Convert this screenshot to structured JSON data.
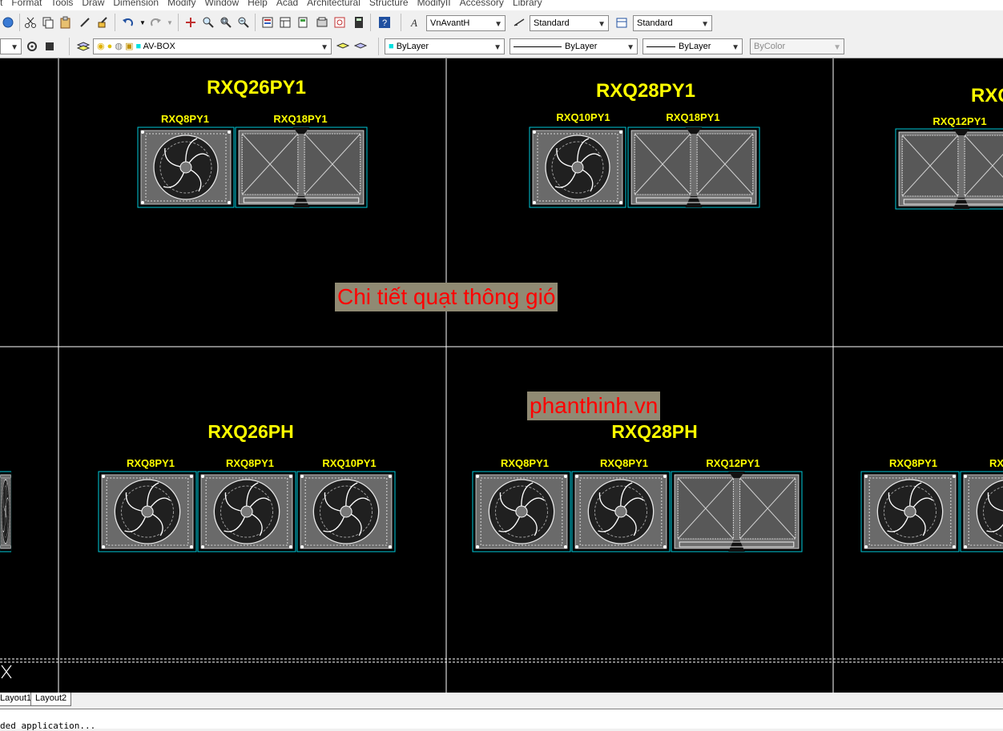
{
  "menu": [
    "t",
    "Format",
    "Tools",
    "Draw",
    "Dimension",
    "Modify",
    "Window",
    "Help",
    "Acad",
    "Architectural",
    "Structure",
    "ModifyII",
    "Accessory",
    "Library"
  ],
  "toolbar1": {
    "text_style": "VnAvantH",
    "dim_style": "Standard",
    "table_style": "Standard"
  },
  "toolbar2": {
    "layer": "AV-BOX",
    "color": "ByLayer",
    "linetype": "ByLayer",
    "lineweight": "ByLayer",
    "plot_style": "ByColor"
  },
  "drawing": {
    "titles": [
      "RXQ26PY1",
      "RXQ28PY1",
      "RXQ",
      "RXQ26PH",
      "RXQ28PH"
    ],
    "module_labels": {
      "g1": [
        "RXQ8PY1",
        "RXQ18PY1"
      ],
      "g2": [
        "RXQ10PY1",
        "RXQ18PY1"
      ],
      "g3": [
        "RXQ12PY1"
      ],
      "g4": [
        "RXQ8PY1",
        "RXQ8PY1",
        "RXQ10PY1"
      ],
      "g5": [
        "RXQ8PY1",
        "RXQ8PY1",
        "RXQ12PY1"
      ],
      "g6": [
        "RXQ8PY1",
        "RX"
      ]
    }
  },
  "overlays": {
    "caption": "Chi tiết quạt thông gió",
    "watermark": "phanthinh.vn"
  },
  "colors": {
    "title": "#ffff00",
    "grid": "#ffffff",
    "frame": "#00ffff",
    "unit": "#8a8a8a",
    "overlay_bg": "#908a73",
    "caption": "#ff0000"
  },
  "layout_tabs": [
    "Layout1",
    "Layout2"
  ],
  "command_line": "ded application..."
}
